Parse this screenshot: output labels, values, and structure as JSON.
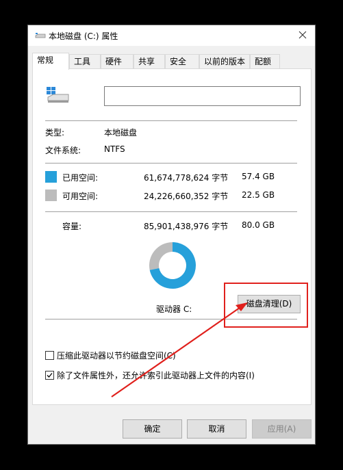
{
  "window": {
    "title": "本地磁盘 (C:) 属性"
  },
  "tabs": [
    {
      "label": "常规",
      "active": true
    },
    {
      "label": "工具"
    },
    {
      "label": "硬件"
    },
    {
      "label": "共享"
    },
    {
      "label": "安全"
    },
    {
      "label": "以前的版本"
    },
    {
      "label": "配额"
    }
  ],
  "general": {
    "name_value": "",
    "type_label": "类型:",
    "type_value": "本地磁盘",
    "fs_label": "文件系统:",
    "fs_value": "NTFS",
    "used": {
      "label": "已用空间:",
      "bytes": "61,674,778,624 字节",
      "size": "57.4 GB",
      "color": "#26a0da"
    },
    "free": {
      "label": "可用空间:",
      "bytes": "24,226,660,352 字节",
      "size": "22.5 GB",
      "color": "#bcbcbc"
    },
    "capacity": {
      "label": "容量:",
      "bytes": "85,901,438,976 字节",
      "size": "80.0 GB"
    },
    "used_fraction": 0.718,
    "drive_label": "驱动器 C:",
    "cleanup_button": "磁盘清理(D)",
    "compress_label": "压缩此驱动器以节约磁盘空间(C)",
    "compress_checked": false,
    "index_label": "除了文件属性外，还允许索引此驱动器上文件的内容(I)",
    "index_checked": true
  },
  "footer": {
    "ok": "确定",
    "cancel": "取消",
    "apply": "应用(A)"
  },
  "annotation_color": "#e0201c"
}
